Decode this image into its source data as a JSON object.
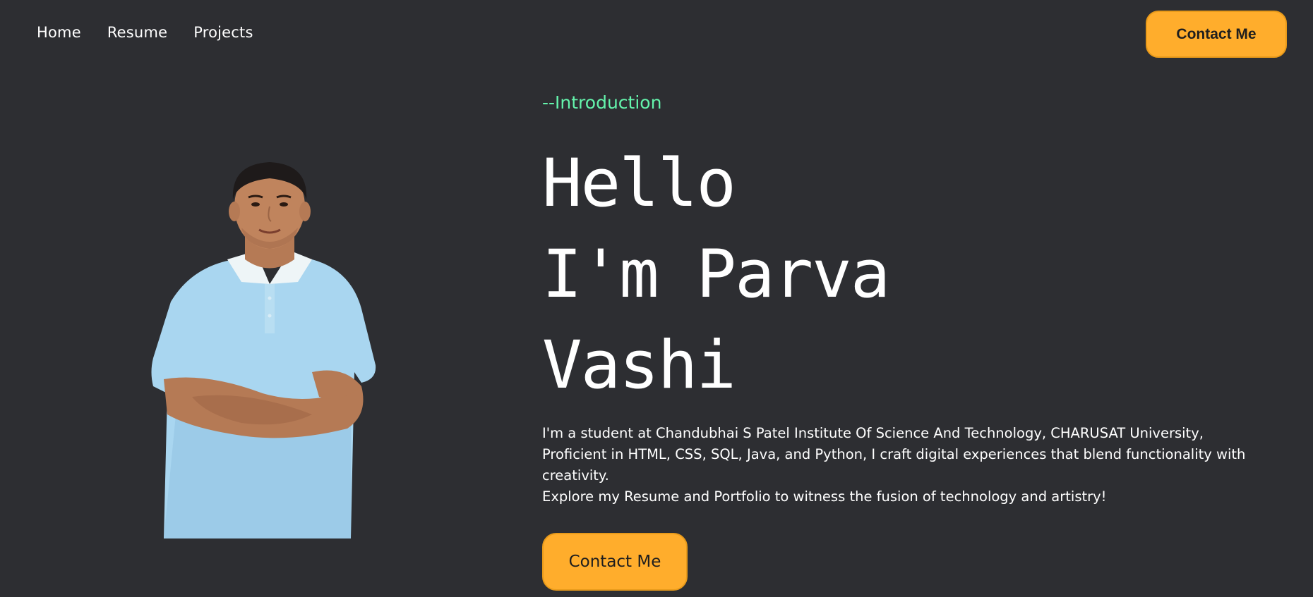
{
  "nav": {
    "links": [
      "Home",
      "Resume",
      "Projects"
    ],
    "cta_label": "Contact Me"
  },
  "hero": {
    "eyebrow": "--Introduction",
    "title_lines": [
      "Hello",
      "I'm Parva",
      "Vashi"
    ],
    "bio_lines": [
      "I'm a student at Chandubhai S Patel Institute Of Science And Technology, CHARUSAT University, Proficient in HTML, CSS, SQL, Java, and Python, I craft digital experiences that blend functionality with creativity.",
      "Explore my Resume and Portfolio to witness the fusion of technology and artistry!"
    ],
    "cta_label": "Contact Me"
  },
  "colors": {
    "background": "#2d2e32",
    "accent": "#ffad2c",
    "eyebrow": "#64f4ac",
    "text": "#ffffff"
  }
}
